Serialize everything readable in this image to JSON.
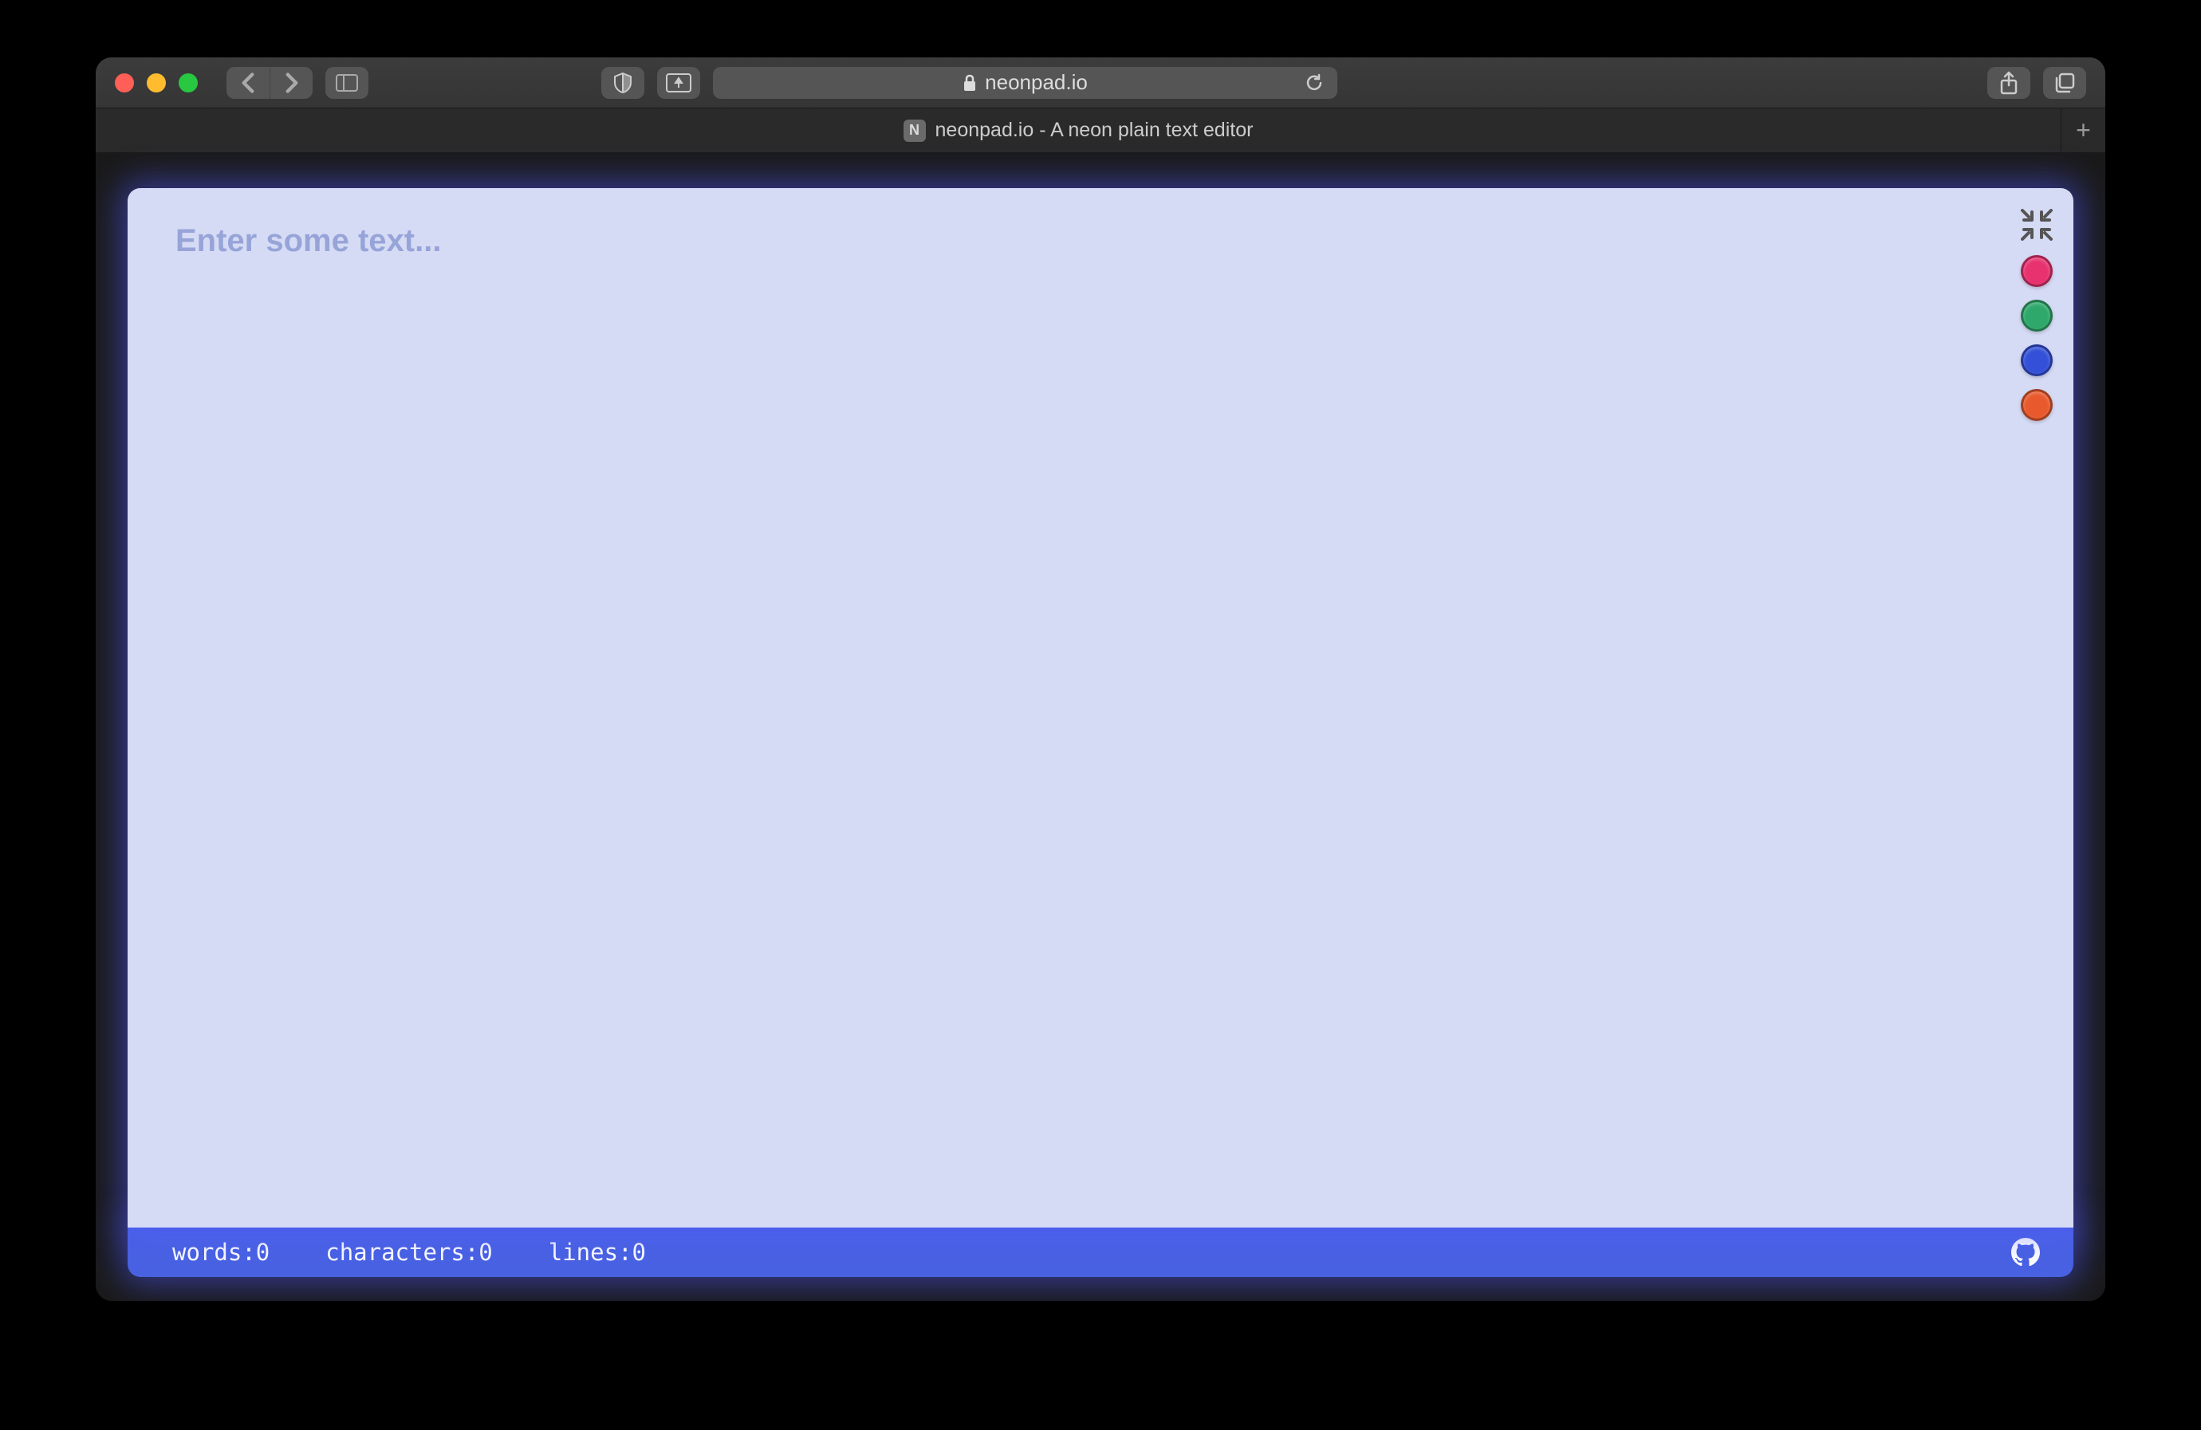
{
  "browser": {
    "url": "neonpad.io",
    "tab_title": "neonpad.io - A neon plain text editor",
    "tab_favicon_letter": "N"
  },
  "editor": {
    "placeholder": "Enter some text...",
    "value": ""
  },
  "theme_colors": {
    "pink": "#e8326f",
    "green": "#2fa86b",
    "blue": "#3450d8",
    "orange": "#e85a2e"
  },
  "status": {
    "words_label": "words: ",
    "words_value": "0",
    "characters_label": "characters: ",
    "characters_value": "0",
    "lines_label": "lines: ",
    "lines_value": "0"
  }
}
